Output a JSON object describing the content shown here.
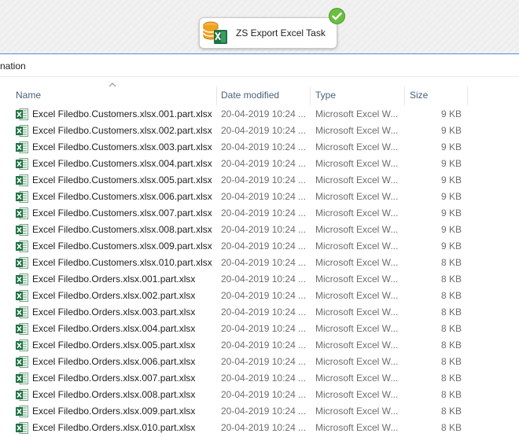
{
  "designer": {
    "task_label": "ZS Export Excel Task",
    "task_icon": "database-excel-icon",
    "status_icon": "green-check-icon",
    "colors": {
      "check": "#6abf3f",
      "accent": "#4a8fd6",
      "db": "#f0a21e",
      "excel": "#1f7244"
    }
  },
  "address": {
    "text": "nation"
  },
  "columns": {
    "name": "Name",
    "date": "Date modified",
    "type": "Type",
    "size": "Size"
  },
  "files": [
    {
      "name": "Excel Filedbo.Customers.xlsx.001.part.xlsx",
      "date": "20-04-2019 10:24 ...",
      "type": "Microsoft Excel W...",
      "size": "9 KB"
    },
    {
      "name": "Excel Filedbo.Customers.xlsx.002.part.xlsx",
      "date": "20-04-2019 10:24 ...",
      "type": "Microsoft Excel W...",
      "size": "9 KB"
    },
    {
      "name": "Excel Filedbo.Customers.xlsx.003.part.xlsx",
      "date": "20-04-2019 10:24 ...",
      "type": "Microsoft Excel W...",
      "size": "9 KB"
    },
    {
      "name": "Excel Filedbo.Customers.xlsx.004.part.xlsx",
      "date": "20-04-2019 10:24 ...",
      "type": "Microsoft Excel W...",
      "size": "9 KB"
    },
    {
      "name": "Excel Filedbo.Customers.xlsx.005.part.xlsx",
      "date": "20-04-2019 10:24 ...",
      "type": "Microsoft Excel W...",
      "size": "9 KB"
    },
    {
      "name": "Excel Filedbo.Customers.xlsx.006.part.xlsx",
      "date": "20-04-2019 10:24 ...",
      "type": "Microsoft Excel W...",
      "size": "9 KB"
    },
    {
      "name": "Excel Filedbo.Customers.xlsx.007.part.xlsx",
      "date": "20-04-2019 10:24 ...",
      "type": "Microsoft Excel W...",
      "size": "9 KB"
    },
    {
      "name": "Excel Filedbo.Customers.xlsx.008.part.xlsx",
      "date": "20-04-2019 10:24 ...",
      "type": "Microsoft Excel W...",
      "size": "9 KB"
    },
    {
      "name": "Excel Filedbo.Customers.xlsx.009.part.xlsx",
      "date": "20-04-2019 10:24 ...",
      "type": "Microsoft Excel W...",
      "size": "9 KB"
    },
    {
      "name": "Excel Filedbo.Customers.xlsx.010.part.xlsx",
      "date": "20-04-2019 10:24 ...",
      "type": "Microsoft Excel W...",
      "size": "8 KB"
    },
    {
      "name": "Excel Filedbo.Orders.xlsx.001.part.xlsx",
      "date": "20-04-2019 10:24 ...",
      "type": "Microsoft Excel W...",
      "size": "8 KB"
    },
    {
      "name": "Excel Filedbo.Orders.xlsx.002.part.xlsx",
      "date": "20-04-2019 10:24 ...",
      "type": "Microsoft Excel W...",
      "size": "8 KB"
    },
    {
      "name": "Excel Filedbo.Orders.xlsx.003.part.xlsx",
      "date": "20-04-2019 10:24 ...",
      "type": "Microsoft Excel W...",
      "size": "8 KB"
    },
    {
      "name": "Excel Filedbo.Orders.xlsx.004.part.xlsx",
      "date": "20-04-2019 10:24 ...",
      "type": "Microsoft Excel W...",
      "size": "8 KB"
    },
    {
      "name": "Excel Filedbo.Orders.xlsx.005.part.xlsx",
      "date": "20-04-2019 10:24 ...",
      "type": "Microsoft Excel W...",
      "size": "8 KB"
    },
    {
      "name": "Excel Filedbo.Orders.xlsx.006.part.xlsx",
      "date": "20-04-2019 10:24 ...",
      "type": "Microsoft Excel W...",
      "size": "8 KB"
    },
    {
      "name": "Excel Filedbo.Orders.xlsx.007.part.xlsx",
      "date": "20-04-2019 10:24 ...",
      "type": "Microsoft Excel W...",
      "size": "8 KB"
    },
    {
      "name": "Excel Filedbo.Orders.xlsx.008.part.xlsx",
      "date": "20-04-2019 10:24 ...",
      "type": "Microsoft Excel W...",
      "size": "8 KB"
    },
    {
      "name": "Excel Filedbo.Orders.xlsx.009.part.xlsx",
      "date": "20-04-2019 10:24 ...",
      "type": "Microsoft Excel W...",
      "size": "8 KB"
    },
    {
      "name": "Excel Filedbo.Orders.xlsx.010.part.xlsx",
      "date": "20-04-2019 10:24 ...",
      "type": "Microsoft Excel W...",
      "size": "8 KB"
    }
  ]
}
